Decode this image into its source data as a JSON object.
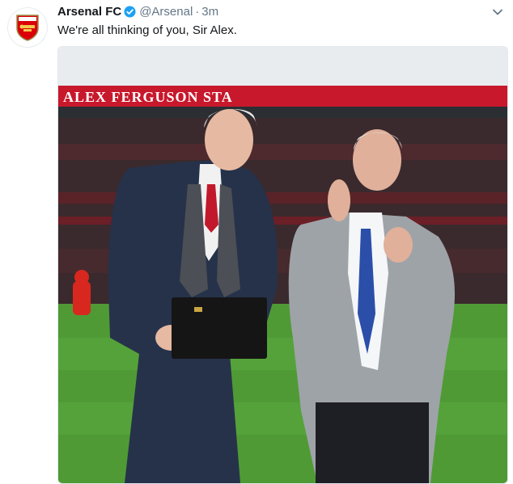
{
  "tweet": {
    "author_name": "Arsenal FC",
    "handle": "@Arsenal",
    "separator": "·",
    "time": "3m",
    "text": "We're all thinking of you, Sir Alex."
  },
  "media": {
    "stadium_sign": "ALEX FERGUSON STA"
  },
  "icons": {
    "avatar": "arsenal-crest-icon",
    "verified": "verified-badge-icon",
    "menu": "chevron-down-icon"
  },
  "colors": {
    "verified_blue": "#1da1f2",
    "arsenal_red": "#db0007",
    "text_secondary": "#657786"
  }
}
